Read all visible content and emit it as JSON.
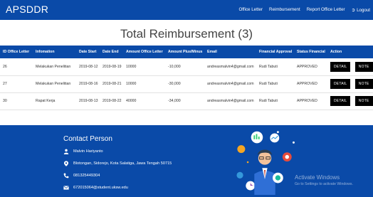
{
  "app": {
    "brand": "APSDDR"
  },
  "nav": {
    "office_letter": "Office Letter",
    "reimbursement": "Reimbursement",
    "report_office_letter": "Report Office Letter",
    "logout": "Logout",
    "logout_icon": "logout-icon"
  },
  "page": {
    "title": "Total Reimbursement (3)"
  },
  "table": {
    "headers": [
      "ID Office Letter",
      "Infomation",
      "Date Start",
      "Date End",
      "Amount Office Letter",
      "Amount Plus/Minus",
      "Email",
      "Financial Approval",
      "Status Financial",
      "Action"
    ],
    "rows": [
      {
        "id": "26",
        "info": "Melakukan Penelitian",
        "start": "2019-08-12",
        "end": "2019-08-19",
        "amount": "10000",
        "plusminus": "-10,000",
        "email": "andreasmalvin4@gmail.com",
        "approval": "Rudi Tabuti",
        "status": "APPROVED",
        "detail": "DETAIL",
        "note": "NOTE"
      },
      {
        "id": "27",
        "info": "Melakukan Penelitian",
        "start": "2019-08-16",
        "end": "2019-08-21",
        "amount": "10000",
        "plusminus": "-30,000",
        "email": "andreasmalvin4@gmail.com",
        "approval": "Rudi Tabuti",
        "status": "APPROVED",
        "detail": "DETAIL",
        "note": "NOTE"
      },
      {
        "id": "30",
        "info": "Rapat Kerja",
        "start": "2019-08-13",
        "end": "2019-08-22",
        "amount": "40000",
        "plusminus": "-34,000",
        "email": "andreasmalvin4@gmail.com",
        "approval": "Rudi Tabuti",
        "status": "APPROVED",
        "detail": "DETAIL",
        "note": "NOTE"
      }
    ]
  },
  "footer": {
    "contact_title": "Contact Person",
    "name": "Malvin Hariyanto",
    "address": "Blotongan, Sidorejo, Kota Salatiga, Jawa Tengah 50715",
    "phone": "081325449304",
    "email": "672015064@student.uksw.edu",
    "icons": [
      "person-icon",
      "location-pin-icon",
      "phone-icon",
      "mail-icon"
    ]
  },
  "watermark": {
    "title": "Activate Windows",
    "subtitle": "Go to Settings to activate Windows."
  },
  "colors": {
    "primary": "#0a4aa8",
    "button": "#000000"
  }
}
